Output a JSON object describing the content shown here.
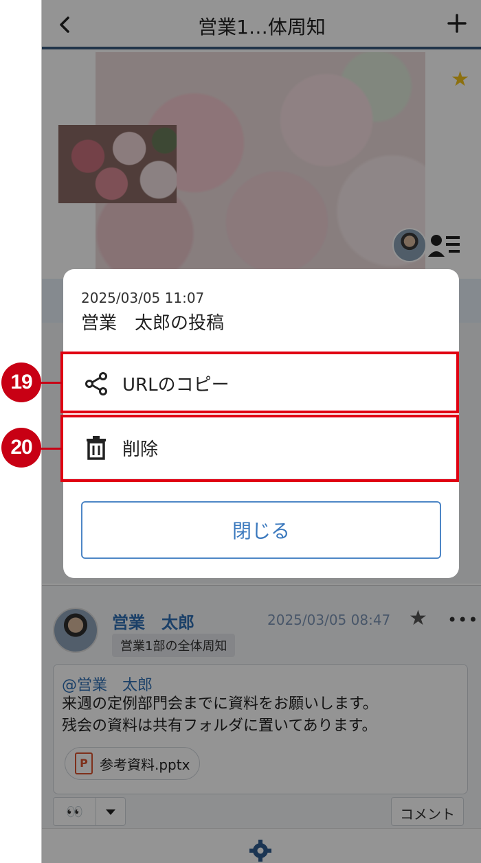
{
  "header": {
    "title": "営業1…体周知"
  },
  "modal": {
    "date": "2025/03/05 11:07",
    "title": "営業　太郎の投稿",
    "items": [
      {
        "label": "URLのコピー",
        "icon": "share-icon"
      },
      {
        "label": "削除",
        "icon": "trash-icon"
      }
    ],
    "close_label": "閉じる"
  },
  "post": {
    "author": "営業　太郎",
    "date": "2025/03/05 08:47",
    "group": "営業1部の全体周知",
    "mention": "@営業　太郎",
    "body": "来週の定例部門会までに資料をお願いします。\n残会の資料は共有フォルダに置いてあります。",
    "attachment": "参考資料.pptx",
    "comment_label": "コメント"
  },
  "callouts": [
    "19",
    "20"
  ],
  "colors": {
    "accent": "#3a78bd",
    "highlight": "#e00012",
    "callout": "#c80014",
    "favorite": "#f2c21b"
  }
}
